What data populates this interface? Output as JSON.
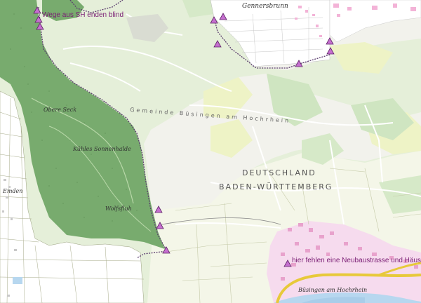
{
  "colors": {
    "forest": "#74a86b",
    "forest_dark": "#5f9a59",
    "meadow": "#e6f1dc",
    "field": "#f5f7ec",
    "pale_yellow": "#eef2c8",
    "settlement": "#f5c6e6",
    "road_yellow": "#f2d44a",
    "river": "#b7d7ef",
    "boundary": "#5b3d6e",
    "marker": "#c66bd0",
    "marker_stroke": "#6d2a72"
  },
  "annotations": {
    "top_note": "Wege aus SH enden blind",
    "bottom_note": "hier fehlen eine Neubaustrasse und Häuser"
  },
  "labels": {
    "country": "DEUTSCHLAND",
    "state": "BADEN-WÜRTTEMBERG",
    "municipality": "Gemeinde Büsingen am Hochrhein",
    "town_top": "Gennersbrunn",
    "town_bottom": "Büsingen am Hochrhein",
    "town_bottom_small": "Büsingen am Hochrhein",
    "forest1": "Obere Seck",
    "forest2": "Kühles Sonnenhalde",
    "forest3": "Wolfsfluh",
    "village_left": "Emden"
  },
  "markers": [
    "marker",
    "marker",
    "marker",
    "marker",
    "marker",
    "marker",
    "marker",
    "marker",
    "marker",
    "marker",
    "marker"
  ]
}
